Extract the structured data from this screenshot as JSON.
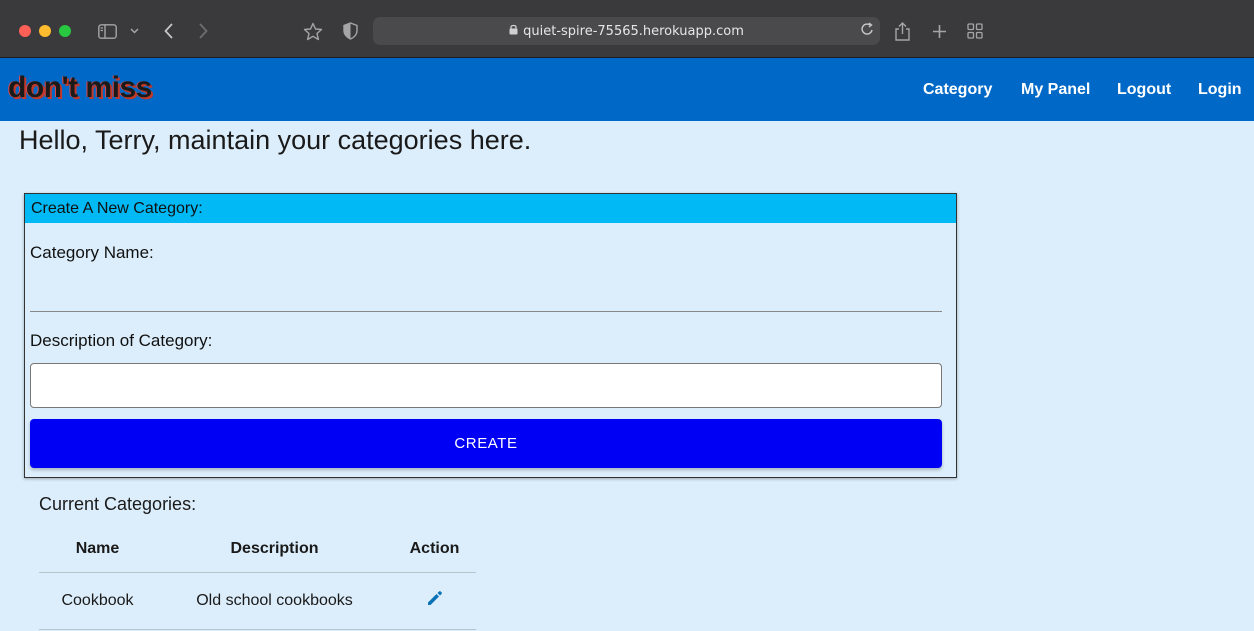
{
  "browser": {
    "url": "quiet-spire-75565.herokuapp.com",
    "icons": {
      "sidebar": "sidebar-icon",
      "back": "chevron-left-icon",
      "forward": "chevron-right-icon",
      "bookmark": "star-icon",
      "shield": "shield-icon",
      "lock": "lock-icon",
      "reload": "reload-icon",
      "share": "share-icon",
      "new_tab": "plus-icon",
      "tabs": "grid-icon"
    }
  },
  "nav": {
    "brand": "don't miss",
    "links": [
      "Category",
      "My Panel",
      "Logout",
      "Login"
    ]
  },
  "greeting": "Hello, Terry, maintain your categories here.",
  "create_form": {
    "header": "Create A New Category:",
    "name_label": "Category Name:",
    "name_value": "",
    "desc_label": "Description of Category:",
    "desc_value": "",
    "button": "CREATE"
  },
  "categories": {
    "title": "Current Categories:",
    "columns": [
      "Name",
      "Description",
      "Action"
    ],
    "rows": [
      {
        "name": "Cookbook",
        "description": "Old school cookbooks",
        "action_icon": "pencil-icon"
      }
    ]
  },
  "colors": {
    "nav_bg": "#0068c6",
    "page_bg": "#dceefb",
    "card_header": "#00b9f5",
    "button_bg": "#0000f5",
    "edit_icon": "#0a73b7"
  }
}
